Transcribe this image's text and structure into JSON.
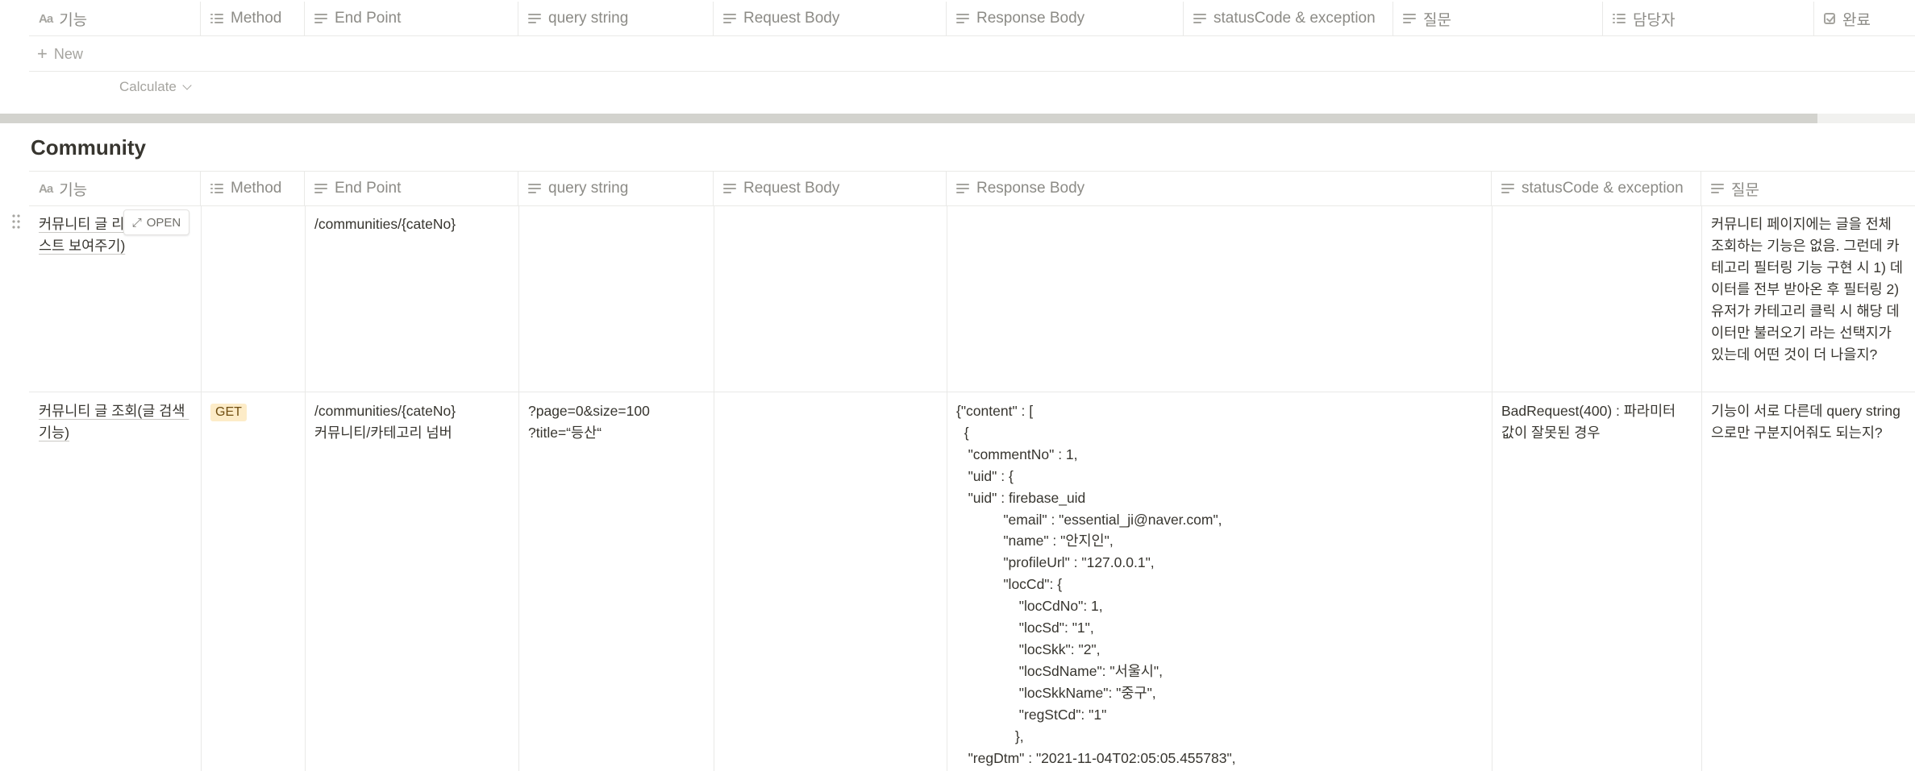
{
  "table1": {
    "columns": [
      {
        "label": "기능",
        "icon": "title-icon"
      },
      {
        "label": "Method",
        "icon": "list-icon"
      },
      {
        "label": "End Point",
        "icon": "text-icon"
      },
      {
        "label": "query string",
        "icon": "text-icon"
      },
      {
        "label": "Request Body",
        "icon": "text-icon"
      },
      {
        "label": "Response Body",
        "icon": "text-icon"
      },
      {
        "label": "statusCode & exception",
        "icon": "text-icon"
      },
      {
        "label": "질문",
        "icon": "text-icon"
      },
      {
        "label": "담당자",
        "icon": "list-icon"
      },
      {
        "label": "완료",
        "icon": "checkbox-icon"
      }
    ],
    "new_label": "New",
    "calculate_label": "Calculate"
  },
  "section": {
    "title": "Community"
  },
  "table2": {
    "columns": [
      {
        "label": "기능",
        "icon": "title-icon"
      },
      {
        "label": "Method",
        "icon": "list-icon"
      },
      {
        "label": "End Point",
        "icon": "text-icon"
      },
      {
        "label": "query string",
        "icon": "text-icon"
      },
      {
        "label": "Request Body",
        "icon": "text-icon"
      },
      {
        "label": "Response Body",
        "icon": "text-icon"
      },
      {
        "label": "statusCode & exception",
        "icon": "text-icon"
      },
      {
        "label": "질문",
        "icon": "text-icon"
      }
    ],
    "open_label": "OPEN",
    "rows": [
      {
        "feature": "커뮤니티 글 리\n스트 보여주기)",
        "method": "",
        "endpoint": "/communities/{cateNo}",
        "query": "",
        "request": "",
        "response": "",
        "status": "",
        "question": "커뮤니티 페이지에는 글을 전체 조회하는 기능은 없음. 그런데 카테고리 필터링 기능 구현 시 1) 데이터를 전부 받아온 후 필터링 2) 유저가 카테고리 클릭 시 해당 데이터만 불러오기 라는 선택지가 있는데 어떤 것이 더 나을지?"
      },
      {
        "feature": "커뮤니티 글 조회(글 검색 기능)",
        "method": "GET",
        "endpoint": "/communities/{cateNo}\n커뮤니티/카테고리 넘버",
        "query": "?page=0&size=100\n?title=“등산“",
        "request": "",
        "response": "{\"content\" : [\n  {\n   \"commentNo\" : 1,\n   \"uid\" : {\n   \"uid\" : firebase_uid\n            \"email\" : \"essential_ji@naver.com\",\n            \"name\" : \"안지인\",\n            \"profileUrl\" : \"127.0.0.1\",\n            \"locCd\": {\n                \"locCdNo\": 1,\n                \"locSd\": \"1\",\n                \"locSkk\": \"2\",\n                \"locSdName\": \"서울시\",\n                \"locSkkName\": \"중구\",\n                \"regStCd\": \"1\"\n               },\n   \"regDtm\" : \"2021-11-04T02:05:05.455783\",",
        "status": "BadRequest(400) : 파라미터 값이 잘못된 경우",
        "question": "기능이 서로 다른데 query string으로만 구분지어줘도 되는지?"
      }
    ]
  }
}
